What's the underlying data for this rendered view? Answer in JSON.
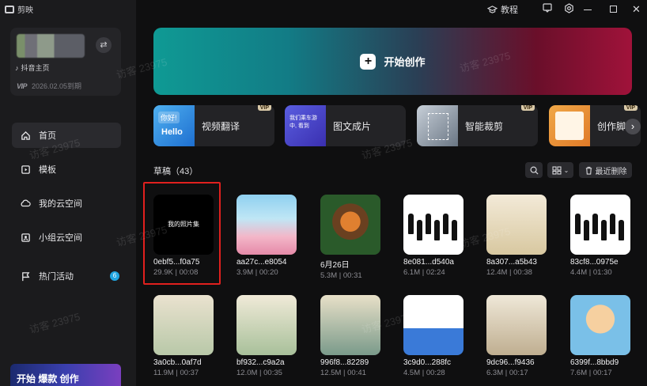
{
  "app": {
    "title": "剪映"
  },
  "window": {
    "tutorial_label": "教程"
  },
  "account": {
    "douyin_label": "抖音主页",
    "vip_text": "2026.02.05到期",
    "vip_badge": "VIP"
  },
  "nav": [
    {
      "label": "首页",
      "icon": "home-icon",
      "active": true
    },
    {
      "label": "模板",
      "icon": "template-icon"
    },
    {
      "label": "我的云空间",
      "icon": "cloud-icon"
    },
    {
      "label": "小组云空间",
      "icon": "team-cloud-icon"
    },
    {
      "label": "热门活动",
      "icon": "flag-icon",
      "badge": "6"
    }
  ],
  "promo": {
    "text": "开始 爆款 创作"
  },
  "hero": {
    "label": "开始创作"
  },
  "tools": [
    {
      "label": "视频翻译",
      "vip": "VIP",
      "thumb_text": "你好!",
      "thumb_sub": "Hello"
    },
    {
      "label": "图文成片",
      "thumb_text": "我们乘车游中, 看到"
    },
    {
      "label": "智能裁剪",
      "vip": "VIP"
    },
    {
      "label": "创作脚",
      "vip": "VIP"
    }
  ],
  "drafts": {
    "title": "草稿（43）",
    "delete_recent": "最近删除",
    "items": [
      {
        "name": "0ebf5...f0a75",
        "meta": "29.9K | 00:08",
        "cover_text": "我的照片集"
      },
      {
        "name": "aa27c...e8054",
        "meta": "3.9M | 00:20"
      },
      {
        "name": "6月26日",
        "meta": "5.3M | 00:31"
      },
      {
        "name": "8e081...d540a",
        "meta": "6.1M | 02:24"
      },
      {
        "name": "8a307...a5b43",
        "meta": "12.4M | 00:38"
      },
      {
        "name": "83cf8...0975e",
        "meta": "4.4M | 01:30"
      },
      {
        "name": "3a0cb...0af7d",
        "meta": "11.9M | 00:37"
      },
      {
        "name": "bf932...c9a2a",
        "meta": "12.0M | 00:35"
      },
      {
        "name": "996f8...82289",
        "meta": "12.5M | 00:41"
      },
      {
        "name": "3c9d0...288fc",
        "meta": "4.5M | 00:28"
      },
      {
        "name": "9dc96...f9436",
        "meta": "6.3M | 00:17"
      },
      {
        "name": "6399f...8bbd9",
        "meta": "7.6M | 00:17"
      }
    ]
  },
  "watermark": "访客 23975",
  "colors": {
    "accent_teal": "#0f9a94",
    "accent_red": "#a0123a",
    "selection": "#e0201e",
    "badge": "#21a5e0"
  }
}
